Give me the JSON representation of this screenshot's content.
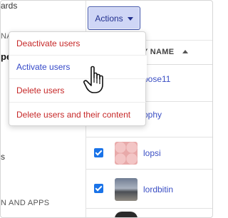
{
  "sidebar": {
    "frag_wards": "ards",
    "frag_na": "NA",
    "frag_pe": "pe",
    "frag_s": "s",
    "frag_apps": "N AND APPS"
  },
  "toolbar": {
    "actions_label": "Actions"
  },
  "actions_menu": {
    "items": [
      {
        "label": "Deactivate users",
        "color": "#c62828"
      },
      {
        "label": "Activate users",
        "color": "#3448c8"
      },
      {
        "label": "Delete users",
        "color": "#c62828"
      },
      {
        "label": "Delete users and their content",
        "color": "#c62828"
      }
    ]
  },
  "table": {
    "column_header": "Y NAME",
    "sort": "ascending",
    "rows": [
      {
        "username": "oose11",
        "checked": null
      },
      {
        "username": "ophy",
        "checked": null
      },
      {
        "username": "lopsi",
        "checked": true
      },
      {
        "username": "lordbitin",
        "checked": true
      }
    ]
  },
  "colors": {
    "accent": "#3448c8",
    "danger": "#c62828",
    "button_bg": "#cfd6f6",
    "checkbox": "#1a73e8"
  },
  "icons": [
    "caret-down-icon",
    "sort-ascending-icon",
    "checkbox-checked-icon",
    "hand-pointer-cursor-icon"
  ]
}
